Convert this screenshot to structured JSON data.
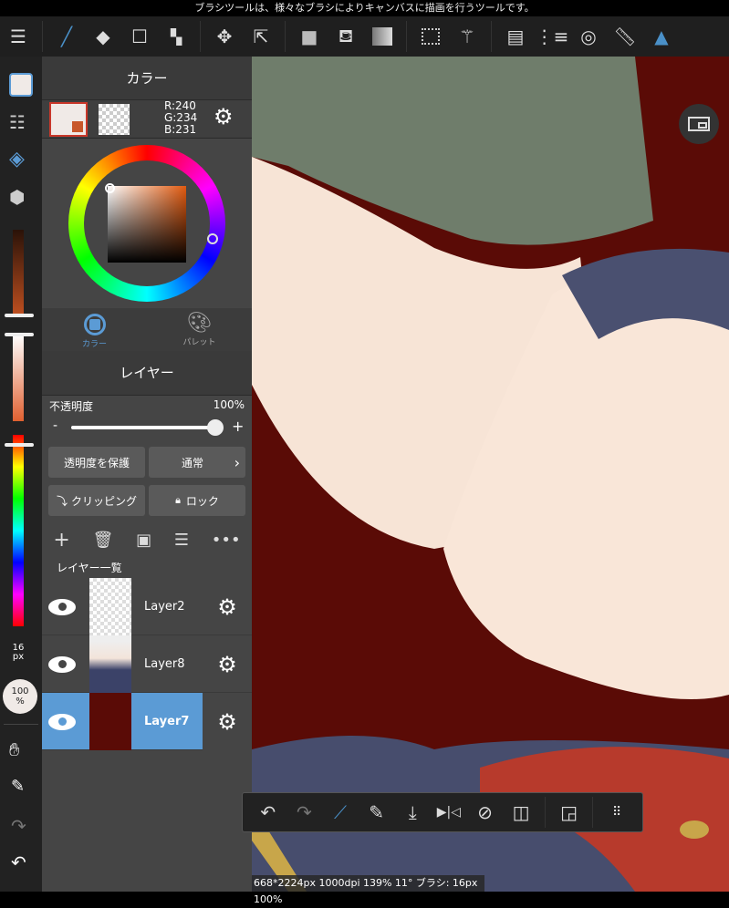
{
  "hint": "ブラシツールは、様々なブラシによりキャンバスに描画を行うツールです。",
  "toolbar": {
    "icons": [
      "menu-icon",
      "brush-icon",
      "eraser-icon",
      "rectangle-icon",
      "dot-icon",
      "move-icon",
      "transform-icon",
      "fill-rect-icon",
      "bucket-icon",
      "gradient-icon",
      "select-icon",
      "magic-wand-icon",
      "layer-panel-icon",
      "select-list-icon",
      "snap-icon",
      "ruler-icon",
      "pen-settings-icon"
    ]
  },
  "color_panel": {
    "title": "カラー",
    "rgb": {
      "r": "R:240",
      "g": "G:234",
      "b": "B:231"
    },
    "primary": "#f0eae7",
    "secondary": "#c8572a",
    "tabs": [
      {
        "label": "カラー"
      },
      {
        "label": "パレット"
      }
    ]
  },
  "layer_panel": {
    "title": "レイヤー",
    "opacity_label": "不透明度",
    "opacity_value": "100%",
    "opacity": 100,
    "minus": "-",
    "plus": "+",
    "protect_alpha": "透明度を保護",
    "blend_mode": "通常",
    "clipping": "クリッピング",
    "lock": "ロック",
    "list_title": "レイヤー一覧",
    "layers": [
      {
        "name": "Layer2",
        "selected": false
      },
      {
        "name": "Layer8",
        "selected": false
      },
      {
        "name": "Layer7",
        "selected": true
      }
    ]
  },
  "left": {
    "brush_size": "16",
    "brush_unit": "px",
    "opacity": "100",
    "opacity_unit": "%"
  },
  "status": "668*2224px 1000dpi 139% 11° ブラシ: 16px 100%",
  "colors": {
    "accent": "#5b9bd5",
    "canvas_bg": "#5a0b06"
  }
}
